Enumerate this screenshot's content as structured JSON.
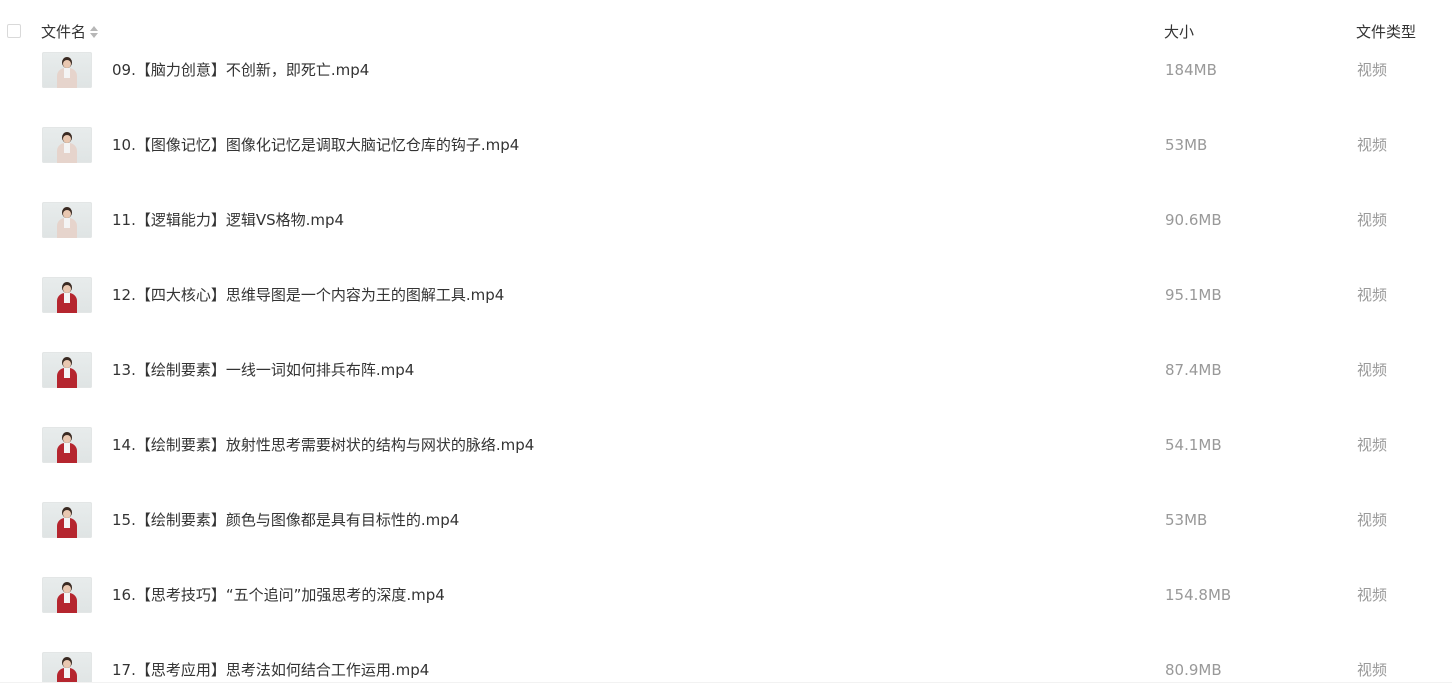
{
  "header": {
    "name_label": "文件名",
    "size_label": "大小",
    "type_label": "文件类型"
  },
  "rows": [
    {
      "name": "09.【脑力创意】不创新，即死亡.mp4",
      "size": "184MB",
      "type": "视频",
      "thumb": "light"
    },
    {
      "name": "10.【图像记忆】图像化记忆是调取大脑记忆仓库的钩子.mp4",
      "size": "53MB",
      "type": "视频",
      "thumb": "light"
    },
    {
      "name": "11.【逻辑能力】逻辑VS格物.mp4",
      "size": "90.6MB",
      "type": "视频",
      "thumb": "light"
    },
    {
      "name": "12.【四大核心】思维导图是一个内容为王的图解工具.mp4",
      "size": "95.1MB",
      "type": "视频",
      "thumb": "red"
    },
    {
      "name": "13.【绘制要素】一线一词如何排兵布阵.mp4",
      "size": "87.4MB",
      "type": "视频",
      "thumb": "red"
    },
    {
      "name": "14.【绘制要素】放射性思考需要树状的结构与网状的脉络.mp4",
      "size": "54.1MB",
      "type": "视频",
      "thumb": "red"
    },
    {
      "name": "15.【绘制要素】颜色与图像都是具有目标性的.mp4",
      "size": "53MB",
      "type": "视频",
      "thumb": "red"
    },
    {
      "name": "16.【思考技巧】“五个追问”加强思考的深度.mp4",
      "size": "154.8MB",
      "type": "视频",
      "thumb": "red"
    },
    {
      "name": "17.【思考应用】思考法如何结合工作运用.mp4",
      "size": "80.9MB",
      "type": "视频",
      "thumb": "red"
    }
  ]
}
